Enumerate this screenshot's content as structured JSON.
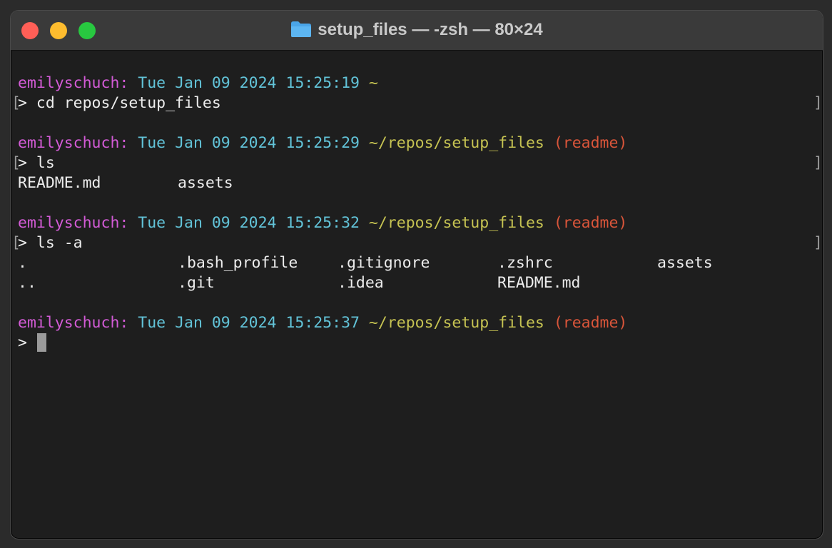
{
  "window": {
    "title": "setup_files — -zsh — 80×24"
  },
  "colors": {
    "user": "#d35bd6",
    "date": "#62c3d8",
    "path": "#c6c352",
    "branch": "#d9553a",
    "background": "#1e1e1e"
  },
  "blocks": [
    {
      "prompt": {
        "user": "emilyschuch:",
        "date": "Tue Jan 09 2024 15:25:19",
        "path": "~",
        "branch": ""
      },
      "command": "> cd repos/setup_files"
    },
    {
      "prompt": {
        "user": "emilyschuch:",
        "date": "Tue Jan 09 2024 15:25:29",
        "path": "~/repos/setup_files",
        "branch": "(readme)"
      },
      "command": "> ls",
      "output_rows": [
        [
          "README.md",
          "assets"
        ]
      ]
    },
    {
      "prompt": {
        "user": "emilyschuch:",
        "date": "Tue Jan 09 2024 15:25:32",
        "path": "~/repos/setup_files",
        "branch": "(readme)"
      },
      "command": "> ls -a",
      "output_rows": [
        [
          ".",
          ".bash_profile",
          ".gitignore",
          ".zshrc",
          "assets"
        ],
        [
          "..",
          ".git",
          ".idea",
          "README.md"
        ]
      ]
    },
    {
      "prompt": {
        "user": "emilyschuch:",
        "date": "Tue Jan 09 2024 15:25:37",
        "path": "~/repos/setup_files",
        "branch": "(readme)"
      },
      "command": ">"
    }
  ],
  "brackets": {
    "left": "[",
    "right": "]"
  }
}
